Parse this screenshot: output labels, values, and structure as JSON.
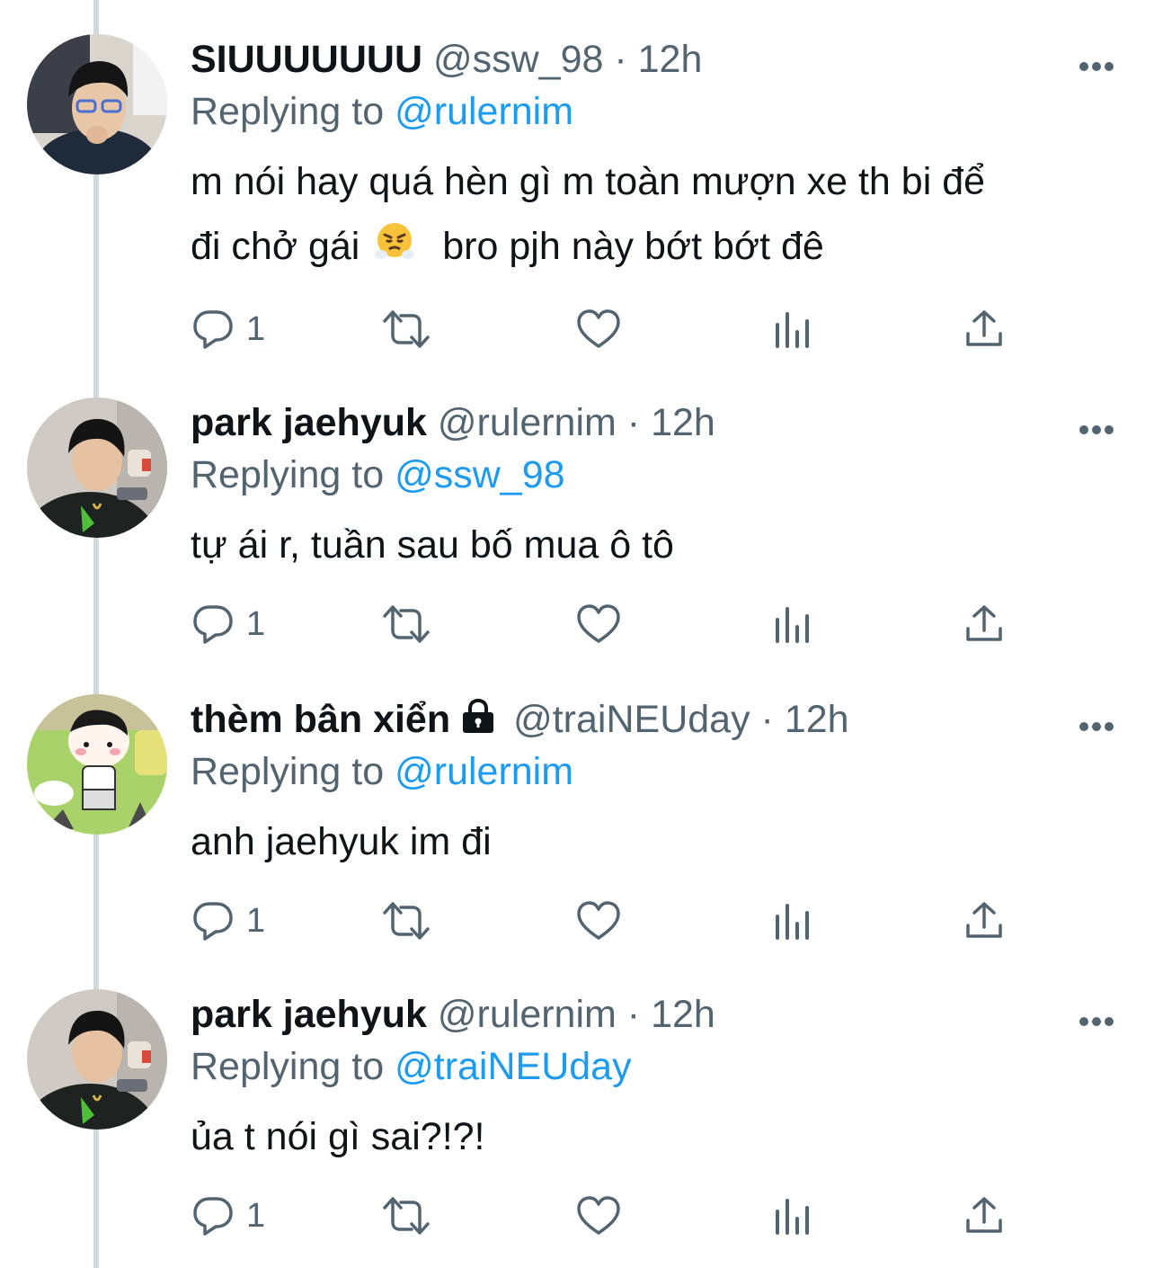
{
  "tweets": [
    {
      "name": "SIUUUUUUU",
      "handle": "@ssw_98",
      "time": "12h",
      "replying_label": "Replying to",
      "replying_to": "@rulernim",
      "text_line1": "m nói hay quá hèn gì m toàn mượn xe th bi để",
      "text_line2a": "đi chở gái",
      "emoji": "face-with-steam-from-nose",
      "text_line2b": "bro pjh này bớt bớt đê",
      "reply_count": "1",
      "locked": false
    },
    {
      "name": "park jaehyuk",
      "handle": "@rulernim",
      "time": "12h",
      "replying_label": "Replying to",
      "replying_to": "@ssw_98",
      "text": "tự ái r, tuần sau bố mua ô tô",
      "reply_count": "1",
      "locked": false
    },
    {
      "name": "thèm bân xiển",
      "handle": "@traiNEUday",
      "time": "12h",
      "replying_label": "Replying to",
      "replying_to": "@rulernim",
      "text": "anh jaehyuk im đi",
      "reply_count": "1",
      "locked": true
    },
    {
      "name": "park jaehyuk",
      "handle": "@rulernim",
      "time": "12h",
      "replying_label": "Replying to",
      "replying_to": "@traiNEUday",
      "text": "ủa t nói gì sai?!?!",
      "reply_count": "1",
      "locked": false
    }
  ],
  "separator": "·",
  "icons": {
    "reply": "reply-icon",
    "retweet": "retweet-icon",
    "like": "heart-icon",
    "views": "views-icon",
    "share": "share-icon",
    "more": "more-icon",
    "lock": "lock-icon"
  },
  "colors": {
    "text": "#0f1419",
    "secondary": "#536471",
    "link": "#1d9bf0",
    "thread_line": "#cfd9de"
  }
}
